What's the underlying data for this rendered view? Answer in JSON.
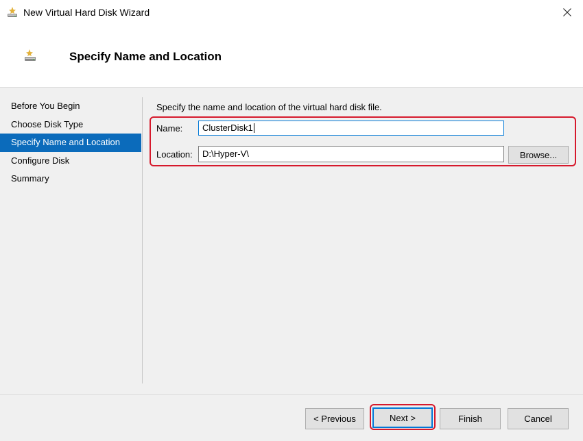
{
  "window": {
    "title": "New Virtual Hard Disk Wizard",
    "title_icon": "disk-wizard-icon",
    "close_icon": "close-icon"
  },
  "header": {
    "icon": "new-disk-icon",
    "title": "Specify Name and Location"
  },
  "nav": {
    "items": [
      {
        "label": "Before You Begin"
      },
      {
        "label": "Choose Disk Type"
      },
      {
        "label": "Specify Name and Location"
      },
      {
        "label": "Configure Disk"
      },
      {
        "label": "Summary"
      }
    ],
    "active_index": 2
  },
  "main": {
    "description": "Specify the name and location of the virtual hard disk file.",
    "name_label": "Name:",
    "name_value": "ClusterDisk1",
    "location_label": "Location:",
    "location_value": "D:\\Hyper-V\\",
    "browse_label": "Browse..."
  },
  "footer": {
    "previous_label": "< Previous",
    "next_label": "Next >",
    "finish_label": "Finish",
    "cancel_label": "Cancel"
  },
  "colors": {
    "accent": "#0b6bbb",
    "highlight": "#d6192c",
    "focus": "#0078d7"
  }
}
